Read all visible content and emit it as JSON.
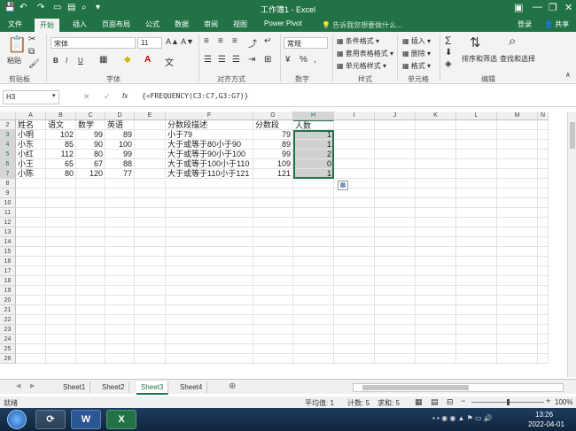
{
  "titlebar": {
    "title": "工作簿1 - Excel"
  },
  "tabs": [
    "文件",
    "开始",
    "插入",
    "页面布局",
    "公式",
    "数据",
    "审阅",
    "视图",
    "Power Pivot"
  ],
  "active_tab": "开始",
  "tell_me": "告诉我您想要做什么...",
  "login": "登录",
  "share": "共享",
  "ribbon": {
    "paste": "粘贴",
    "clipboard": "剪贴板",
    "font_name": "宋体",
    "font_size": "11",
    "font_group": "字体",
    "align_group": "对齐方式",
    "number_format": "常规",
    "number_group": "数字",
    "cond_format": "条件格式",
    "table_format": "套用表格格式",
    "cell_style": "单元格样式",
    "style_group": "样式",
    "insert": "插入",
    "delete": "删除",
    "format": "格式",
    "cells_group": "单元格",
    "sort_filter": "排序和筛选",
    "find_select": "查找和选择",
    "edit_group": "编辑",
    "bold": "B",
    "italic": "I",
    "underline": "U"
  },
  "formula_bar": {
    "name_box": "H3",
    "fx": "fx",
    "formula": "{=FREQUENCY(C3:C7,G3:G7)}"
  },
  "columns": [
    "A",
    "B",
    "C",
    "D",
    "E",
    "F",
    "G",
    "H",
    "I",
    "J",
    "K",
    "L",
    "M",
    "N"
  ],
  "rows": [
    "2",
    "3",
    "4",
    "5",
    "6",
    "7",
    "8",
    "9",
    "10",
    "11",
    "12",
    "13",
    "14",
    "15",
    "16",
    "17",
    "18",
    "19",
    "20",
    "21",
    "22",
    "23",
    "24",
    "25",
    "26"
  ],
  "header_row": {
    "A": "姓名",
    "B": "语文",
    "C": "数学",
    "D": "英语",
    "F": "分数段描述",
    "G": "分数段",
    "H": "人数"
  },
  "data_rows": [
    {
      "A": "小明",
      "B": "102",
      "C": "99",
      "D": "89",
      "F": "小于79",
      "G": "79",
      "H": "1"
    },
    {
      "A": "小东",
      "B": "85",
      "C": "90",
      "D": "100",
      "F": "大于或等于80小于90",
      "G": "89",
      "H": "1"
    },
    {
      "A": "小红",
      "B": "112",
      "C": "80",
      "D": "99",
      "F": "大于或等于90小于100",
      "G": "99",
      "H": "2"
    },
    {
      "A": "小王",
      "B": "65",
      "C": "67",
      "D": "88",
      "F": "大于或等于100小于110",
      "G": "109",
      "H": "0"
    },
    {
      "A": "小陈",
      "B": "80",
      "C": "120",
      "D": "77",
      "F": "大于或等于110小于121",
      "G": "121",
      "H": "1"
    }
  ],
  "sheets": [
    "Sheet1",
    "Sheet2",
    "Sheet3",
    "Sheet4"
  ],
  "active_sheet": "Sheet3",
  "status": {
    "ready": "就绪",
    "average": "平均值: 1",
    "count": "计数: 5",
    "sum": "求和: 5",
    "zoom": "100%"
  },
  "taskbar": {
    "time": "13:26",
    "date": "2022-04-01",
    "word": "W",
    "excel": "X"
  },
  "colors": {
    "accent": "#217346",
    "selection": "#d0d0d0"
  }
}
